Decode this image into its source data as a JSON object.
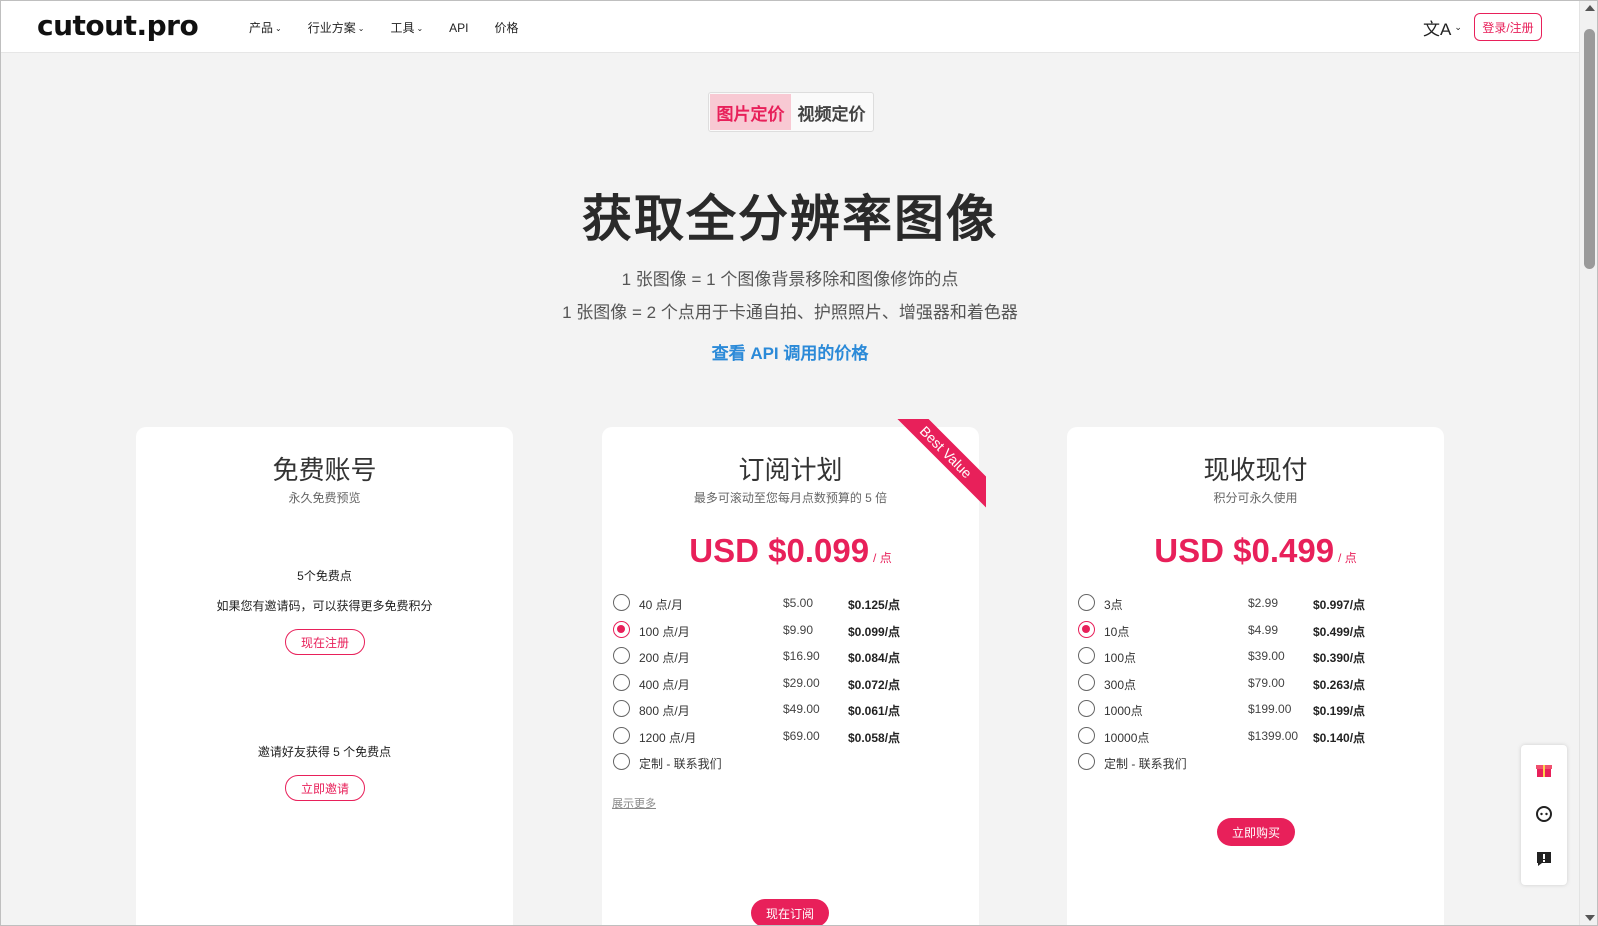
{
  "header": {
    "logo": "cutout.pro",
    "nav": [
      "产品",
      "行业方案",
      "工具",
      "API",
      "价格"
    ],
    "lang_icon": "文A",
    "login": "登录/注册"
  },
  "toggle": {
    "image": "图片定价",
    "video": "视频定价"
  },
  "hero": {
    "title": "获取全分辨率图像",
    "line1": "1 张图像 = 1 个图像背景移除和图像修饰的点",
    "line2": "1 张图像 = 2 个点用于卡通自拍、护照照片、增强器和着色器",
    "api_link": "查看 API 调用的价格"
  },
  "free": {
    "title": "免费账号",
    "subtitle": "永久免费预览",
    "points": "5个免费点",
    "invite_code": "如果您有邀请码，可以获得更多免费积分",
    "register": "现在注册",
    "invite_text": "邀请好友获得 5 个免费点",
    "invite_btn": "立即邀请"
  },
  "subscription": {
    "title": "订阅计划",
    "subtitle": "最多可滚动至您每月点数预算的 5 倍",
    "ribbon": "Best Value",
    "price": "USD $0.099",
    "unit": "/ 点",
    "plans": [
      {
        "name": "40 点/月",
        "price": "$5.00",
        "per": "$0.125/点",
        "checked": false
      },
      {
        "name": "100 点/月",
        "price": "$9.90",
        "per": "$0.099/点",
        "checked": true
      },
      {
        "name": "200 点/月",
        "price": "$16.90",
        "per": "$0.084/点",
        "checked": false
      },
      {
        "name": "400 点/月",
        "price": "$29.00",
        "per": "$0.072/点",
        "checked": false
      },
      {
        "name": "800 点/月",
        "price": "$49.00",
        "per": "$0.061/点",
        "checked": false
      },
      {
        "name": "1200 点/月",
        "price": "$69.00",
        "per": "$0.058/点",
        "checked": false
      },
      {
        "name": "定制 - 联系我们",
        "price": "",
        "per": "",
        "checked": false
      }
    ],
    "show_more": "展示更多",
    "subscribe": "现在订阅"
  },
  "paygo": {
    "title": "现收现付",
    "subtitle": "积分可永久使用",
    "price": "USD $0.499",
    "unit": "/ 点",
    "plans": [
      {
        "name": "3点",
        "price": "$2.99",
        "per": "$0.997/点",
        "checked": false
      },
      {
        "name": "10点",
        "price": "$4.99",
        "per": "$0.499/点",
        "checked": true
      },
      {
        "name": "100点",
        "price": "$39.00",
        "per": "$0.390/点",
        "checked": false
      },
      {
        "name": "300点",
        "price": "$79.00",
        "per": "$0.263/点",
        "checked": false
      },
      {
        "name": "1000点",
        "price": "$199.00",
        "per": "$0.199/点",
        "checked": false
      },
      {
        "name": "10000点",
        "price": "$1399.00",
        "per": "$0.140/点",
        "checked": false
      },
      {
        "name": "定制 - 联系我们",
        "price": "",
        "per": "",
        "checked": false
      }
    ],
    "buy": "立即购买"
  },
  "side_widget": [
    "gift-icon",
    "support-icon",
    "feedback-icon"
  ],
  "colors": {
    "accent": "#e8205a",
    "link": "#2b8ad8"
  }
}
